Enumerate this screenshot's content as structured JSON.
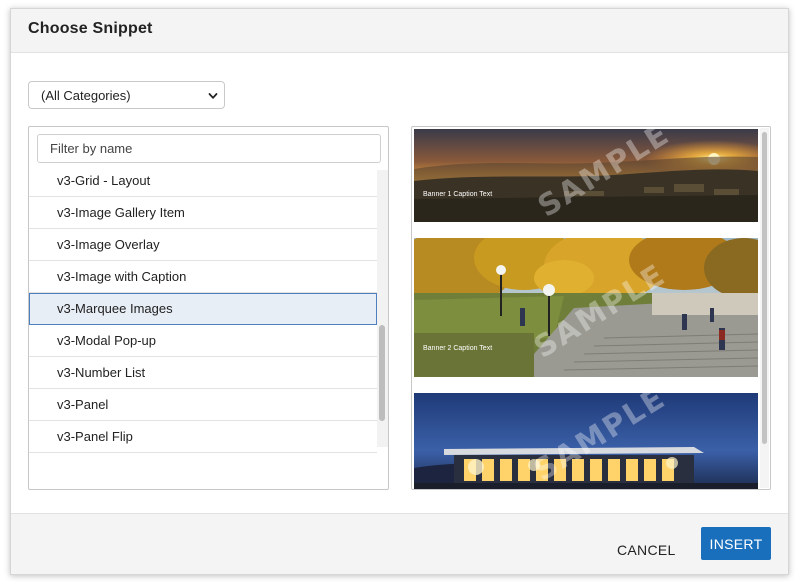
{
  "dialog": {
    "title": "Choose Snippet"
  },
  "category": {
    "selected": "(All Categories)"
  },
  "filter": {
    "placeholder": "Filter by name"
  },
  "snippets": {
    "items": [
      "v3-Grid - Layout",
      "v3-Image Gallery Item",
      "v3-Image Overlay",
      "v3-Image with Caption",
      "v3-Marquee Images",
      "v3-Modal Pop-up",
      "v3-Number List",
      "v3-Panel",
      "v3-Panel Flip"
    ],
    "selected": "v3-Marquee Images"
  },
  "preview": {
    "banners": [
      {
        "caption": "Banner 1 Caption Text",
        "watermark": "SAMPLE"
      },
      {
        "caption": "Banner 2 Caption Text",
        "watermark": "SAMPLE"
      },
      {
        "caption": "",
        "watermark": "SAMPLE"
      }
    ]
  },
  "footer": {
    "cancel_label": "CANCEL",
    "insert_label": "INSERT"
  },
  "colors": {
    "primary": "#1a6fbd",
    "selected_bg": "#e8eef6",
    "selected_border": "#4d7fbf"
  }
}
